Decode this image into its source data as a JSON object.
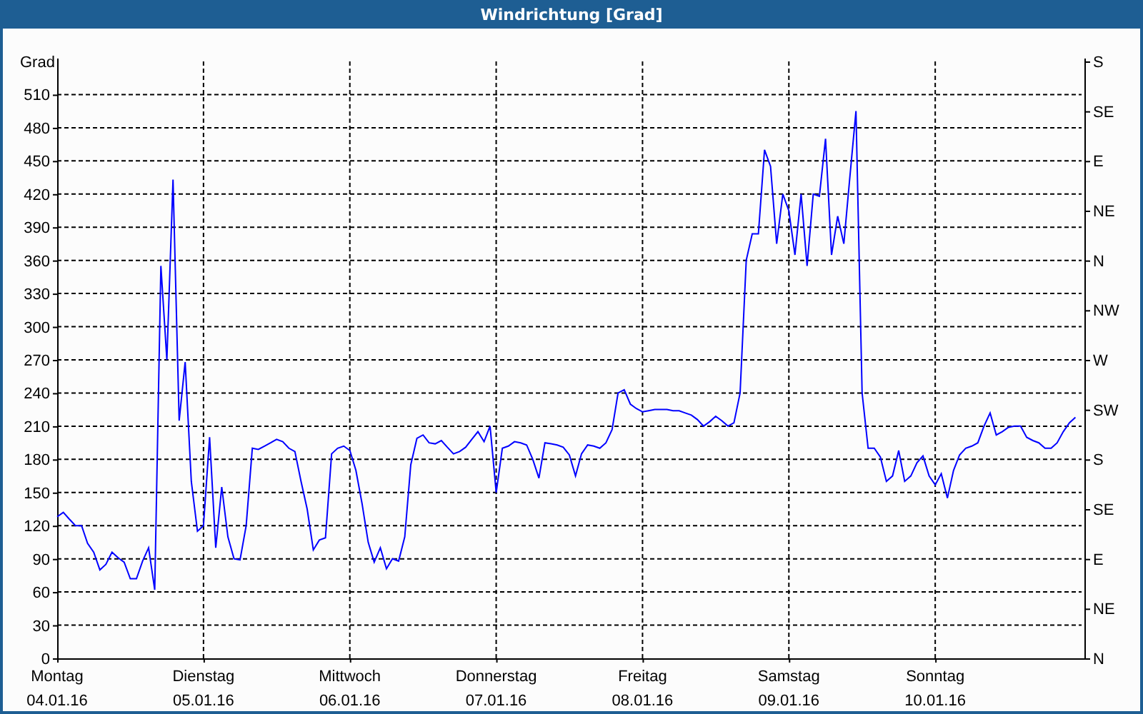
{
  "window": {
    "title": "Windrichtung [Grad]"
  },
  "panel": {
    "compass_ticks": [
      "S",
      "SE",
      "E",
      "NE",
      "N",
      "NW",
      "W",
      "SW",
      "S",
      "SE",
      "E",
      "NE",
      "N"
    ],
    "chart_data": {
      "type": "line",
      "ylabel": "Grad",
      "grid": true,
      "ylim": [
        0,
        540
      ],
      "yticks": [
        0,
        30,
        60,
        90,
        120,
        150,
        180,
        210,
        240,
        270,
        300,
        330,
        360,
        390,
        420,
        450,
        480,
        510
      ],
      "categories": [
        "Montag 04.01.16",
        null,
        null,
        null,
        null,
        null,
        null,
        null,
        null,
        null,
        null,
        null,
        null,
        null,
        null,
        null,
        null,
        null,
        null,
        null,
        null,
        null,
        null,
        null,
        "Dienstag 05.01.16",
        null,
        null,
        null,
        null,
        null,
        null,
        null,
        null,
        null,
        null,
        null,
        null,
        null,
        null,
        null,
        null,
        null,
        null,
        null,
        null,
        null,
        null,
        null,
        "Mittwoch 06.01.16",
        null,
        null,
        null,
        null,
        null,
        null,
        null,
        null,
        null,
        null,
        null,
        null,
        null,
        null,
        null,
        null,
        null,
        null,
        null,
        null,
        null,
        null,
        null,
        "Donnerstag 07.01.16",
        null,
        null,
        null,
        null,
        null,
        null,
        null,
        null,
        null,
        null,
        null,
        null,
        null,
        null,
        null,
        null,
        null,
        null,
        null,
        null,
        null,
        null,
        null,
        "Freitag 08.01.16",
        null,
        null,
        null,
        null,
        null,
        null,
        null,
        null,
        null,
        null,
        null,
        null,
        null,
        null,
        null,
        null,
        null,
        null,
        null,
        null,
        null,
        null,
        null,
        "Samstag 09.01.16",
        null,
        null,
        null,
        null,
        null,
        null,
        null,
        null,
        null,
        null,
        null,
        null,
        null,
        null,
        null,
        null,
        null,
        null,
        null,
        null,
        null,
        null,
        null,
        "Sonntag 10.01.16",
        null,
        null,
        null,
        null,
        null,
        null,
        null,
        null,
        null,
        null,
        null,
        null,
        null,
        null,
        null,
        null,
        null,
        null,
        null,
        null,
        null,
        null,
        null
      ],
      "series": [
        {
          "color": "#0000ff",
          "values": [
            128,
            132,
            126,
            120,
            120,
            104,
            96,
            80,
            85,
            96,
            91,
            87,
            72,
            72,
            88,
            100,
            62,
            355,
            270,
            433,
            215,
            268,
            160,
            115,
            120,
            200,
            100,
            155,
            110,
            90,
            89,
            120,
            190,
            189,
            192,
            195,
            198,
            196,
            190,
            187,
            160,
            135,
            98,
            107,
            109,
            185,
            190,
            192,
            188,
            170,
            140,
            105,
            87,
            100,
            81,
            90,
            88,
            110,
            175,
            199,
            202,
            195,
            194,
            197,
            191,
            185,
            187,
            191,
            198,
            205,
            196,
            210,
            150,
            190,
            192,
            196,
            195,
            193,
            180,
            163,
            195,
            194,
            193,
            191,
            184,
            165,
            185,
            193,
            192,
            190,
            195,
            207,
            240,
            243,
            230,
            226,
            223,
            224,
            225,
            225,
            225,
            224,
            224,
            222,
            220,
            216,
            210,
            214,
            219,
            215,
            210,
            213,
            240,
            360,
            384,
            384,
            460,
            445,
            375,
            420,
            405,
            365,
            420,
            355,
            420,
            418,
            470,
            365,
            400,
            375,
            435,
            495,
            240,
            190,
            190,
            182,
            160,
            165,
            188,
            160,
            165,
            177,
            183,
            165,
            157,
            167,
            145,
            170,
            184,
            190,
            192,
            195,
            210,
            222,
            202,
            205,
            209,
            210,
            210,
            200,
            197,
            195,
            190,
            190,
            195,
            205,
            213,
            218
          ]
        }
      ]
    }
  }
}
